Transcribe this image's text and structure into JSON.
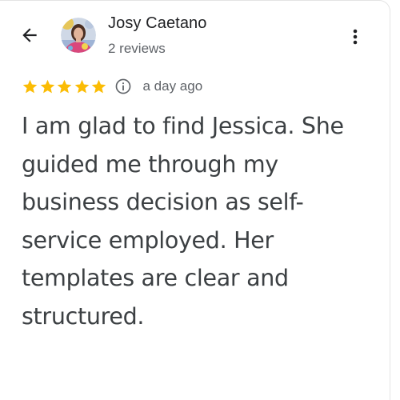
{
  "header": {
    "back_icon": "arrow-left-icon",
    "author_name": "Josy Caetano",
    "review_count": "2 reviews",
    "more_icon": "more-vertical-icon"
  },
  "review": {
    "rating": 5,
    "max_rating": 5,
    "star_color": "#FBBC04",
    "info_icon": "info-icon",
    "date": "a day ago",
    "text": "I am glad to find Jessica. She guided me through my business decision as self-service employed. Her templates are clear and structured."
  }
}
